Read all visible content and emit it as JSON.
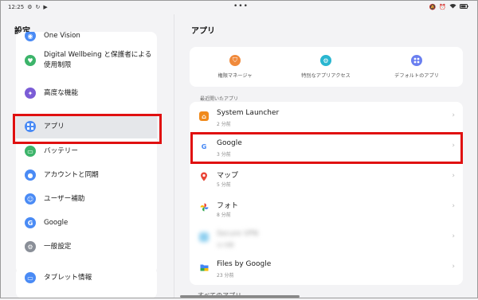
{
  "status_bar": {
    "time": "12:25",
    "left_icons": [
      "gear-icon",
      "sync-icon",
      "play-icon"
    ],
    "right_icons": [
      "mute-icon",
      "alarm-icon",
      "wifi-icon",
      "battery-icon"
    ],
    "more": "•••"
  },
  "left": {
    "title": "設定",
    "items": [
      {
        "label": "One Vision",
        "icon": "one-vision-icon",
        "color": "#4a8bf5"
      },
      {
        "label": "Digital Wellbeing と保護者による使用制限",
        "icon": "wellbeing-icon",
        "color": "#3cb46a"
      },
      {
        "label": "高度な機能",
        "icon": "advanced-features-icon",
        "color": "#7b5cd6"
      },
      {
        "label": "アプリ",
        "icon": "apps-icon",
        "color": "#4a8bf5",
        "active": true
      },
      {
        "label": "バッテリー",
        "icon": "battery-icon",
        "color": "#3cb46a"
      },
      {
        "label": "アカウントと同期",
        "icon": "account-icon",
        "color": "#4a8bf5"
      },
      {
        "label": "ユーザー補助",
        "icon": "accessibility-icon",
        "color": "#4a8bf5"
      },
      {
        "label": "Google",
        "icon": "google-icon",
        "color": "#4a8bf5"
      },
      {
        "label": "一般設定",
        "icon": "general-settings-icon",
        "color": "#8a8f98"
      }
    ],
    "bottom_item": {
      "label": "タブレット情報",
      "icon": "tablet-info-icon",
      "color": "#4a8bf5"
    }
  },
  "right": {
    "title": "アプリ",
    "defaults": [
      {
        "label": "権限マネージャ",
        "icon": "permission-manager-icon",
        "color": "#f08a3c"
      },
      {
        "label": "特別なアプリアクセス",
        "icon": "special-access-icon",
        "color": "#29b6d0"
      },
      {
        "label": "デフォルトのアプリ",
        "icon": "default-apps-icon",
        "color": "#6a7ff0"
      }
    ],
    "recent_label": "最近開いたアプリ",
    "recent_apps": [
      {
        "name": "System Launcher",
        "sub": "2 分前",
        "icon": "system-launcher-icon",
        "color": "#f08a1c"
      },
      {
        "name": "Google",
        "sub": "3 分前",
        "icon": "google-icon"
      },
      {
        "name": "マップ",
        "sub": "5 分前",
        "icon": "maps-icon"
      },
      {
        "name": "フォト",
        "sub": "8 分前",
        "icon": "photos-icon"
      },
      {
        "name": "Secure VPN",
        "sub": "12 分前",
        "icon": "vpn-icon",
        "blurred": true
      },
      {
        "name": "Files by Google",
        "sub": "23 分前",
        "icon": "files-icon"
      }
    ],
    "bottom_peek": "すべてのアプリ"
  },
  "colors": {
    "highlight": "#e01010",
    "background": "#f3f3f5",
    "card": "#ffffff"
  }
}
